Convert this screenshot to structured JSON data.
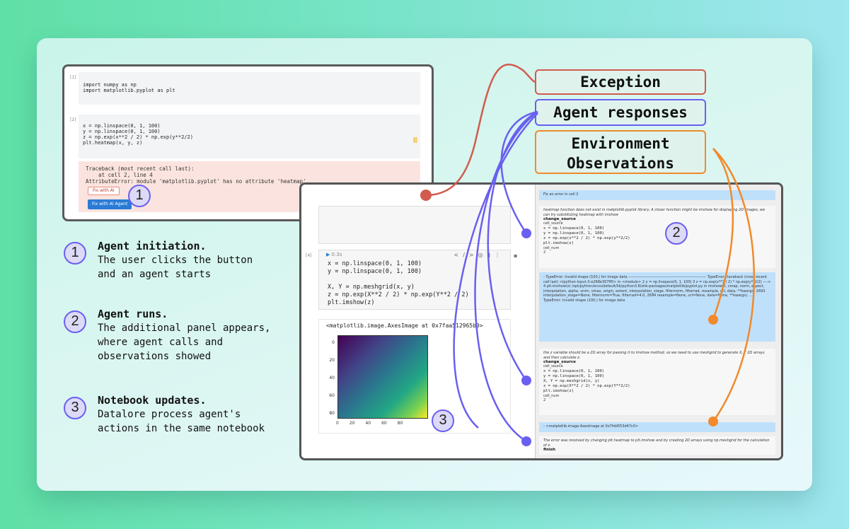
{
  "legend": {
    "exception": "Exception",
    "agent_responses": "Agent responses",
    "env_line1": "Environment",
    "env_line2": "Observations",
    "colors": {
      "exception": "#d15b4f",
      "agent": "#6a5ff0",
      "env": "#f08a2c"
    }
  },
  "steps": [
    {
      "num": "1",
      "title": "Agent initiation.",
      "desc": "The user clicks the button\nand an agent starts"
    },
    {
      "num": "2",
      "title": "Agent runs.",
      "desc": "The additional panel appears,\nwhere agent calls and\nobservations showed"
    },
    {
      "num": "3",
      "title": "Notebook updates.",
      "desc": "Datalore process agent's\nactions in the same notebook"
    }
  ],
  "notebook1": {
    "cell1_num": "[1]",
    "cell1_code": "import numpy as np\nimport matplotlib.pyplot as plt",
    "cell2_num": "[2]",
    "cell2_code": "x = np.linspace(0, 1, 100)\ny = np.linspace(0, 1, 100)\nz = np.exp(x**2 / 2) * np.exp(y**2/2)\nplt.heatmap(x, y, z)",
    "traceback": "Traceback (most recent call last):\n    at cell 2, line 4\nAttributeError: module 'matplotlib.pyplot' has no attribute 'heatmap'",
    "fix_ai": "Fix with AI",
    "fix_agent": "Fix with AI Agent"
  },
  "notebook2": {
    "cell_num": "[4]",
    "exec_time": "0.3s",
    "code": "x = np.linspace(0, 1, 100)\ny = np.linspace(0, 1, 100)\n\nX, Y = np.meshgrid(x, y)\nz = np.exp(X**2 / 2) * np.exp(Y**2 / 2)\nplt.imshow(z)",
    "output_repr": "<matplotlib.image.AxesImage at 0x7faa512965b0>",
    "y_ticks": [
      "0",
      "20",
      "40",
      "60",
      "80"
    ],
    "x_ticks": [
      "0",
      "20",
      "40",
      "60",
      "80"
    ]
  },
  "agent_panel": {
    "prompt": "Fix an error in cell 2",
    "resp1_text": "heatmap function does not exist in matplotlib.pyplot library. A closer function might be imshow for displaying 2D images, we can try substituting heatmap with imshow",
    "change_source": "change_source",
    "cell_source": "cell_source",
    "resp1_code": "x = np.linspace(0, 1, 100)\ny = np.linspace(0, 1, 100)\nz = np.exp(x**2 / 2) * np.exp(y**2/2)\nplt.imshow(z)",
    "cell_num": "cell_num",
    "cell_num_val": "2",
    "obs1_text": "- TypeError: Invalid shape (100,) for image data ------------------------------------------------------------- TypeError Traceback (most recent call last) <ipython-input-3-e268e307ff0> in <module> 2 y = np.linspace(0, 1, 100) 3 z = np.exp(x**2 / 2) * np.exp(y**2/2) ----> 4 plt.imshow(z) /opt/python/envs/default/lib/python3.8/site-packages/matplotlib/pyplot.py in imshow(X, cmap, norm, aspect, interpolation, alpha, vmin, vmax, origin, extent, interpolation_stage, filternorm, filterrad, resample, url, data, **kwargs) 2693 interpolation_stage=None, filternorm=True, filterrad=4.0, 2694 resample=None, url=None, data=None, **kwargs): ... TypeError: Invalid shape (100,) for image data",
    "resp2_text": "the z variable should be a 2D array for passing it to imshow method, so we need to use meshgrid to generate X, Y 2D arrays and then calculate z.",
    "resp2_code": "x = np.linspace(0, 1, 100)\ny = np.linspace(0, 1, 100)\nX, Y = np.meshgrid(x, y)\nz = np.exp(X**2 / 2) * np.exp(Y**2/2)\nplt.imshow(z)",
    "obs2_text": "- <matplotlib.image.AxesImage at 0x7fdd553d47c0>",
    "final_text": "The error was resolved by changing plt.heatmap to plt.imshow and by creating 2D arrays using np.meshgrid for the calculation of z.",
    "finish": "finish"
  }
}
